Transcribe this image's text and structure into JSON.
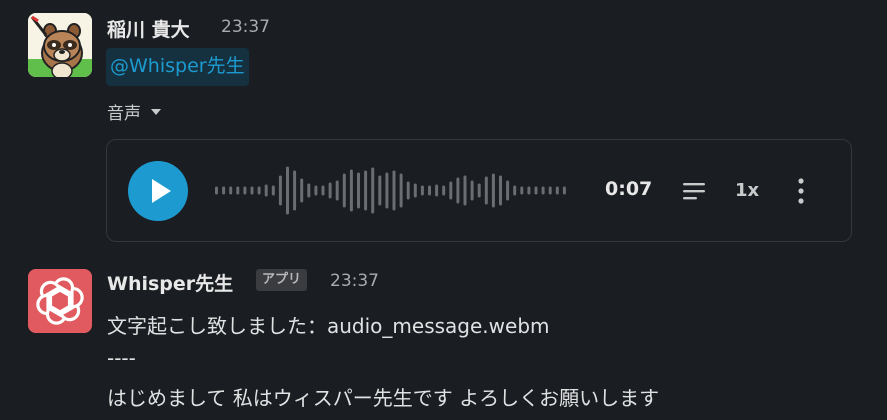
{
  "messages": [
    {
      "author": "稲川 貴大",
      "time": "23:37",
      "mention": "@Whisper先生",
      "attachment": {
        "section_label": "音声",
        "duration": "0:07",
        "speed": "1x",
        "accent_color": "#1d9bd1"
      }
    },
    {
      "author": "Whisper先生",
      "badge": "アプリ",
      "time": "23:37",
      "lines": [
        "文字起こし致しました：audio_message.webm",
        "----",
        "はじめまして 私はウィスパー先生です よろしくお願いします"
      ],
      "avatar_color": "#e05a5f"
    }
  ],
  "icons": {
    "play": "play-icon",
    "transcript": "transcript-icon",
    "more": "more-vertical-icon",
    "caret": "caret-down-icon",
    "openai_logo": "openai-logo-icon",
    "tanuki_avatar": "tanuki-avatar"
  }
}
